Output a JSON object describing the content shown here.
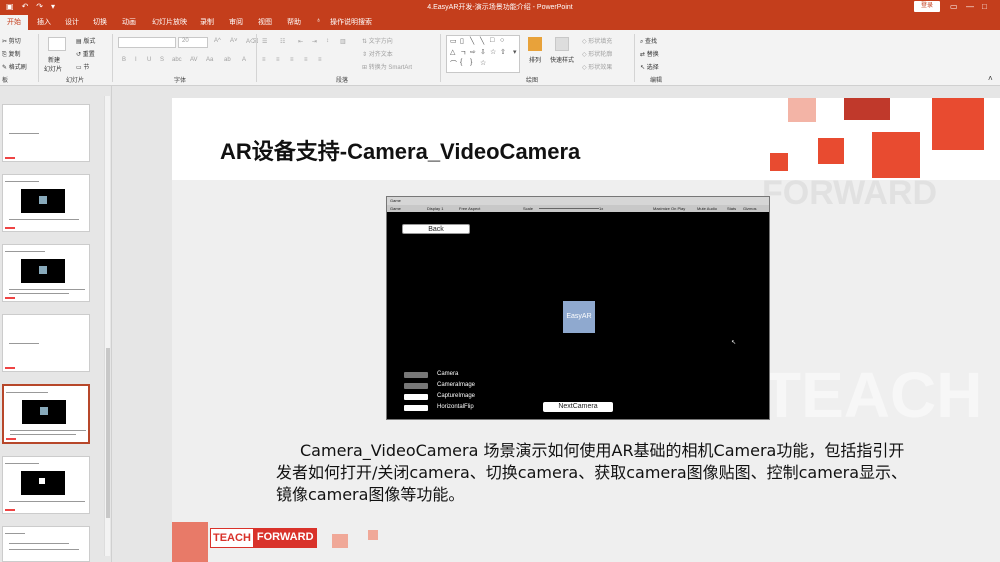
{
  "window": {
    "title": "4.EasyAR开发-演示场景功能介绍 - PowerPoint",
    "login_label": "登录",
    "colors": {
      "accent": "#c43e1c",
      "slide_red": "#e84b30"
    }
  },
  "ribbon_tabs": [
    "开始",
    "插入",
    "设计",
    "切换",
    "动画",
    "幻灯片放映",
    "录制",
    "审阅",
    "视图",
    "帮助",
    "操作说明搜索"
  ],
  "ribbon": {
    "clipboard": {
      "cut": "剪切",
      "copy": "复制",
      "format_painter": "格式刷",
      "group": "板"
    },
    "slides": {
      "new_slide": "新建",
      "new_slide2": "幻灯片",
      "layout": "版式",
      "reset": "重置",
      "section": "节",
      "group": "幻灯片"
    },
    "font": {
      "size": "20",
      "group": "字体"
    },
    "paragraph": {
      "text_direction": "文字方向",
      "align_text": "对齐文本",
      "smartart": "转换为 SmartArt",
      "group": "段落"
    },
    "drawing": {
      "arrange": "排列",
      "quick_styles": "快速样式",
      "fill": "形状填充",
      "outline": "形状轮廓",
      "effects": "形状效果",
      "group": "绘图"
    },
    "editing": {
      "find": "查找",
      "replace": "替换",
      "select": "选择",
      "group": "编辑"
    }
  },
  "slide": {
    "title": "AR设备支持-Camera_VideoCamera",
    "game_window": {
      "tab": "Game",
      "display": "Display 1",
      "aspect": "Free Aspect",
      "scale_label": "Scale",
      "scale_value": "1x",
      "maximize": "Maximize On Play",
      "mute": "Mute Audio",
      "stats": "Stats",
      "gizmos": "Gizmos",
      "back_button": "Back",
      "logo": "EasyAR",
      "toggles": [
        "Camera",
        "CameraImage",
        "CaptureImage",
        "HorizontalFlip"
      ],
      "next_button": "NextCamera"
    },
    "description": "Camera_VideoCamera 场景演示如何使用AR基础的相机Camera功能，包括指引开发者如何打开/关闭camera、切换camera、获取camera图像贴图、控制camera显示、镜像camera图像等功能。",
    "footer_logo_a": "TEACH",
    "footer_logo_b": "FORWARD",
    "watermark_a": "FORWARD",
    "watermark_b": "TEACH"
  }
}
